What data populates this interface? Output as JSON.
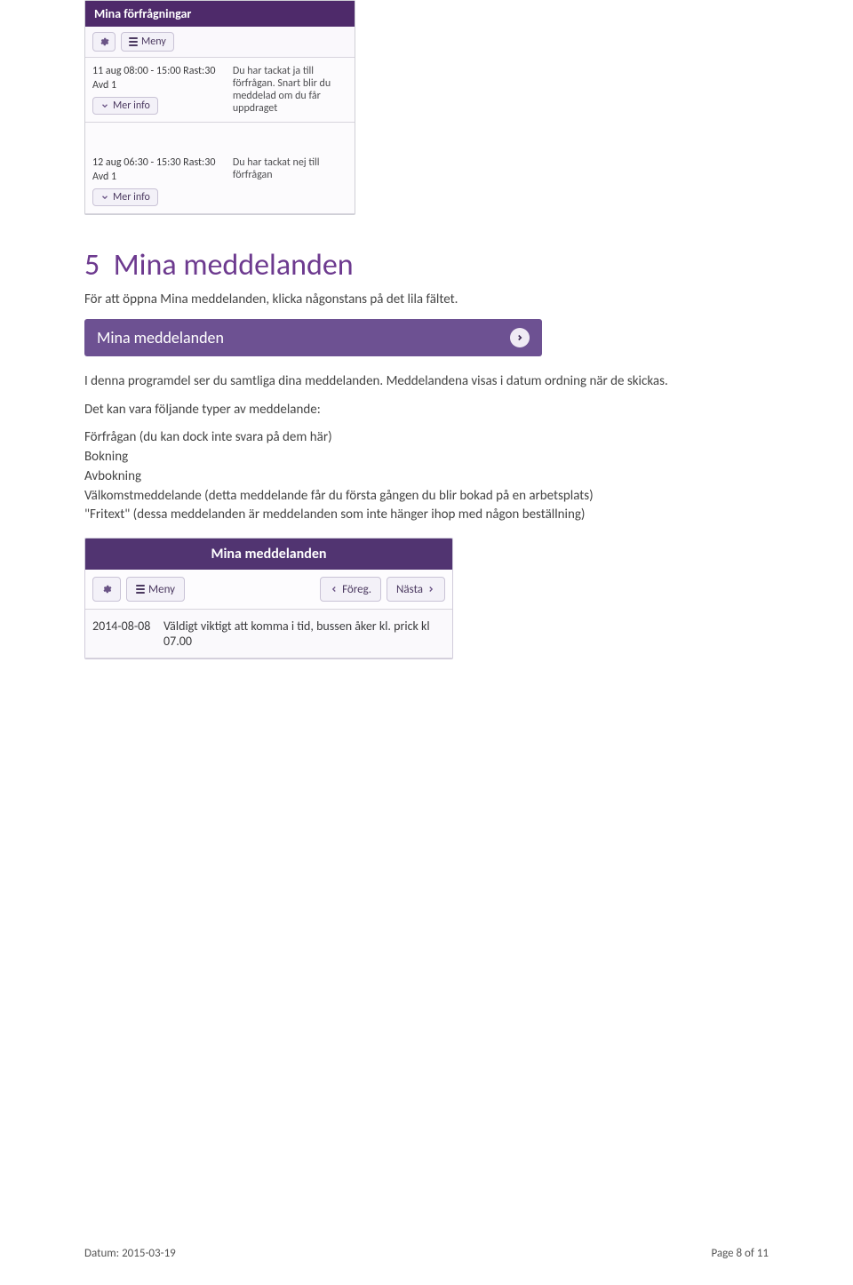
{
  "shot1": {
    "title": "Mina förfrågningar",
    "menu_label": "Meny",
    "items": [
      {
        "time": "11 aug 08:00 - 15:00 Rast:30",
        "dept": "Avd 1",
        "more": "Mer info",
        "status": "Du har tackat ja till förfrågan. Snart blir du meddelad om du får uppdraget"
      },
      {
        "time": "12 aug 06:30 - 15:30 Rast:30",
        "dept": "Avd 1",
        "more": "Mer info",
        "status": "Du har tackat nej till förfrågan"
      }
    ]
  },
  "section": {
    "number_title": "5",
    "heading": "Mina meddelanden",
    "intro": "För att öppna Mina meddelanden, klicka någonstans på det lila fältet.",
    "p1": "I denna programdel ser du samtliga dina meddelanden. Meddelandena visas i datum ordning när de skickas.",
    "p2": "Det kan vara följande typer av meddelande:",
    "types": [
      "Förfrågan (du kan dock inte svara på dem här)",
      "Bokning",
      "Avbokning",
      "Välkomstmeddelande (detta meddelande får du första gången du blir bokad på en arbetsplats)",
      "\"Fritext\" (dessa meddelanden är meddelanden som inte hänger ihop med någon beställning)"
    ]
  },
  "shot2": {
    "label": "Mina meddelanden"
  },
  "shot3": {
    "title": "Mina meddelanden",
    "menu_label": "Meny",
    "prev_label": "Föreg.",
    "next_label": "Nästa",
    "row": {
      "date": "2014-08-08",
      "msg": "Väldigt viktigt att komma i tid, bussen åker kl. prick kl 07.00"
    }
  },
  "footer": {
    "left": "Datum: 2015-03-19",
    "right": "Page 8 of 11"
  }
}
